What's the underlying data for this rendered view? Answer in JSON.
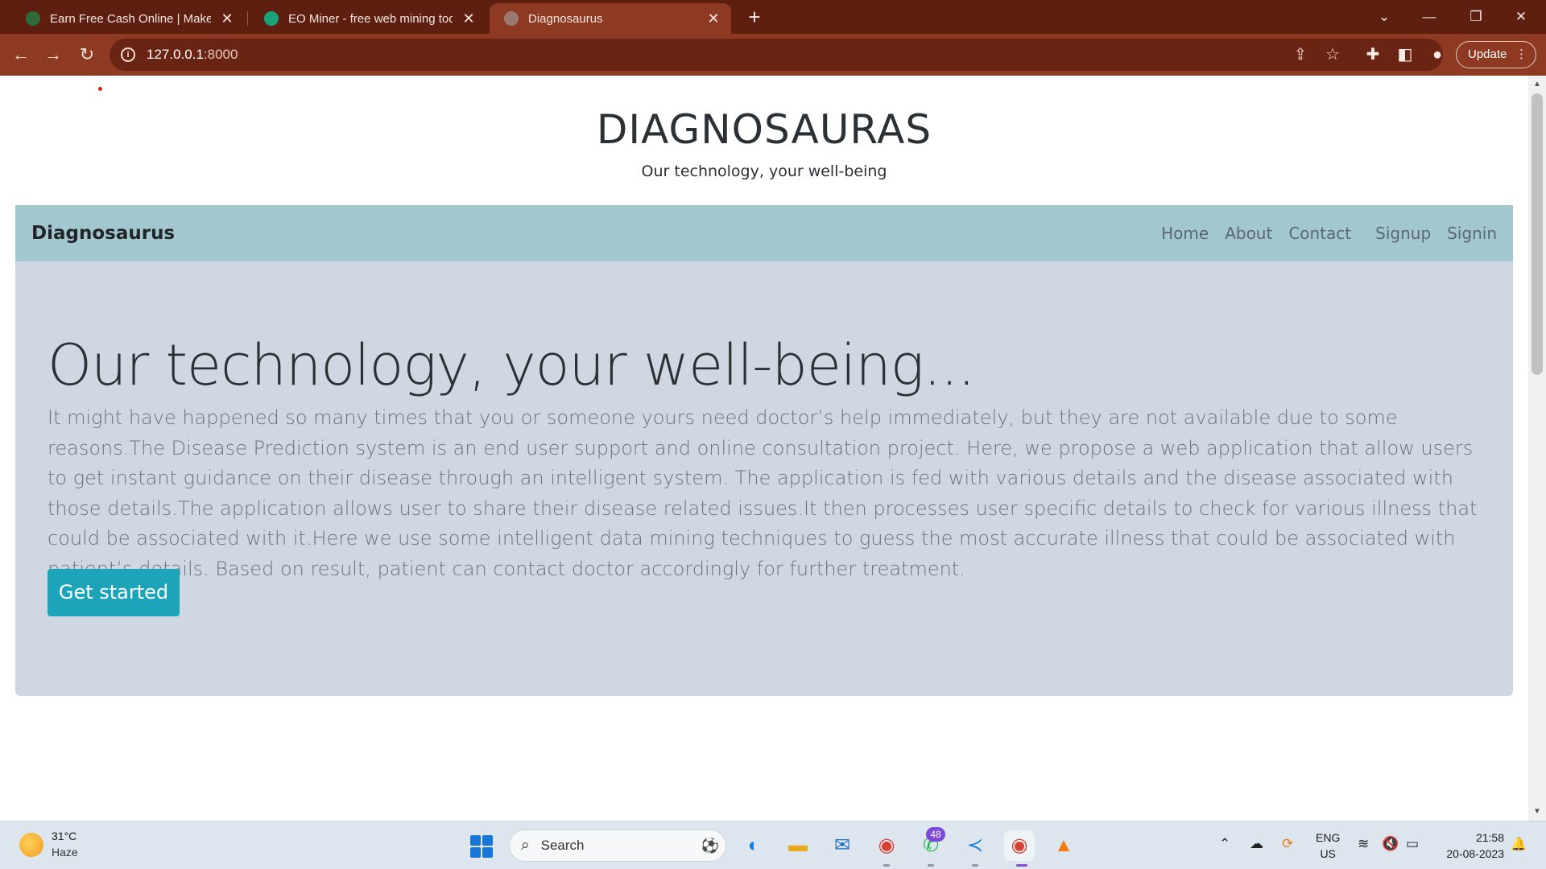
{
  "browser": {
    "tabs": [
      {
        "title": "Earn Free Cash Online | Make Ext",
        "icon": "swirl-icon",
        "color": "#2d6b3a"
      },
      {
        "title": "EO Miner - free web mining tool",
        "icon": "eo-miner-icon",
        "color": "#1aa37a"
      },
      {
        "title": "Diagnosaurus",
        "icon": "globe-icon",
        "color": "#9a7a70"
      }
    ],
    "active_tab_index": 2,
    "new_tab_symbol": "+",
    "window_controls": {
      "tab_search": "⌄",
      "minimize": "—",
      "restore": "❐",
      "close": "✕"
    },
    "url_host": "127.0.0.1",
    "url_port": ":8000",
    "update_label": "Update"
  },
  "site": {
    "title": "DIAGNOSAURAS",
    "subtitle": "Our technology, your well-being",
    "brand": "Diagnosaurus",
    "nav": [
      "Home",
      "About",
      "Contact",
      "Signup",
      "Signin"
    ]
  },
  "hero": {
    "heading": "Our technology, your well-being...",
    "body": "It might have happened so many times that you or someone yours need doctor’s help immediately, but they are not available due to some reasons.The Disease Prediction system is an end user support and online consultation project. Here, we propose a web application that allow users to get instant guidance on their disease through an intelligent system. The application is fed with various details and the disease associated with those details.The application allows user to share their disease related issues.It then processes user specific details to check for various illness that could be associated with it.Here we use some intelligent data mining techniques to guess the most accurate illness that could be associated with patient’s details. Based on result, patient can contact doctor accordingly for further treatment.",
    "cta_label": "Get started"
  },
  "colors": {
    "tabbar": "#5e1f10",
    "toolbar": "#8e3a22",
    "navbar": "#a3c7cf",
    "jumbotron": "#cfd7e2",
    "cta": "#1ea4b9"
  },
  "taskbar": {
    "temperature": "31°C",
    "weather": "Haze",
    "search_placeholder": "Search",
    "whatsapp_badge": "48",
    "lang_line1": "ENG",
    "lang_line2": "US",
    "time": "21:58",
    "date": "20-08-2023"
  }
}
